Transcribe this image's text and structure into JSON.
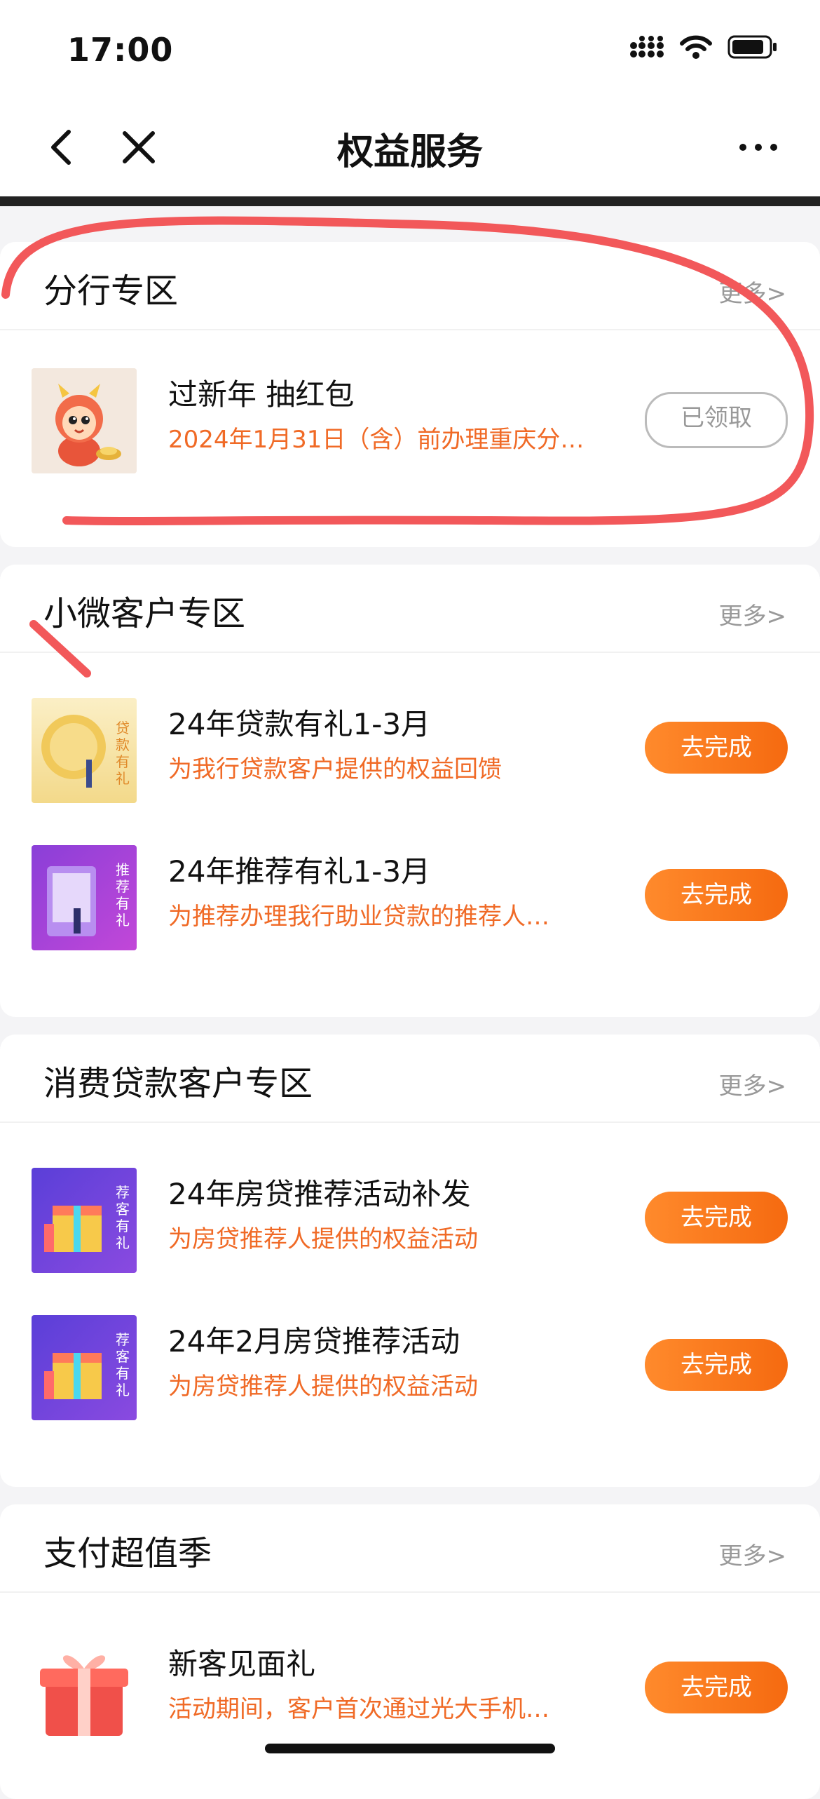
{
  "status_bar": {
    "time": "17:00"
  },
  "nav": {
    "title": "权益服务"
  },
  "sections": [
    {
      "title": "分行专区",
      "more": "更多>",
      "items": [
        {
          "title": "过新年 抽红包",
          "subtitle": "2024年1月31日（含）前办理重庆分…",
          "button": "已领取",
          "icon": "dragon-mascot-icon"
        }
      ]
    },
    {
      "title": "小微客户专区",
      "more": "更多>",
      "items": [
        {
          "title": "24年贷款有礼1-3月",
          "subtitle": "为我行贷款客户提供的权益回馈",
          "button": "去完成",
          "icon": "loan-gift-icon",
          "thumb_text": "贷款有礼"
        },
        {
          "title": "24年推荐有礼1-3月",
          "subtitle": "为推荐办理我行助业贷款的推荐人…",
          "button": "去完成",
          "icon": "referral-gift-icon",
          "thumb_text": "推荐有礼"
        }
      ]
    },
    {
      "title": "消费贷款客户专区",
      "more": "更多>",
      "items": [
        {
          "title": "24年房贷推荐活动补发",
          "subtitle": "为房贷推荐人提供的权益活动",
          "button": "去完成",
          "icon": "referral-customer-gift-icon",
          "thumb_text": "荐客有礼"
        },
        {
          "title": "24年2月房贷推荐活动",
          "subtitle": "为房贷推荐人提供的权益活动",
          "button": "去完成",
          "icon": "referral-customer-gift-icon",
          "thumb_text": "荐客有礼"
        }
      ]
    },
    {
      "title": "支付超值季",
      "more": "更多>",
      "items": [
        {
          "title": "新客见面礼",
          "subtitle": "活动期间，客户首次通过光大手机…",
          "button": "去完成",
          "icon": "gift-box-icon"
        }
      ]
    }
  ]
}
